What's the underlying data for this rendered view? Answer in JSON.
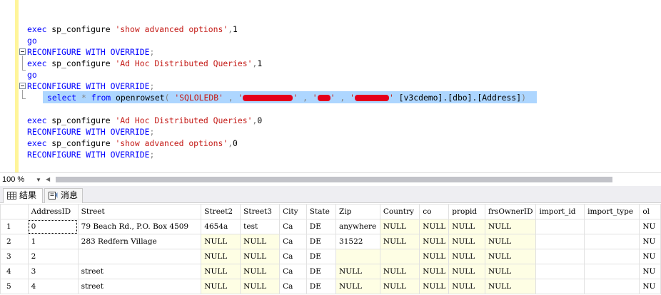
{
  "editor": {
    "lines": [
      {
        "exec": "exec",
        "proc": "sp_configure",
        "arg": "'show advanced options'",
        "sep": ",",
        "val": "1"
      },
      {
        "go": "go"
      },
      {
        "reconfig": "RECONFIGURE WITH OVERRIDE",
        "semi": ";"
      },
      {
        "exec": "exec",
        "proc": "sp_configure",
        "arg": "'Ad Hoc Distributed Queries'",
        "sep": ",",
        "val": "1"
      },
      {
        "go": "go"
      },
      {
        "reconfig": "RECONFIGURE WITH OVERRIDE",
        "semi": ";"
      },
      {
        "exec": "exec",
        "proc": "sp_configure",
        "arg": "'Ad Hoc Distributed Queries'",
        "sep": ",",
        "val": "0"
      },
      {
        "reconfig": "RECONFIGURE WITH OVERRIDE",
        "semi": ";"
      },
      {
        "exec": "exec",
        "proc": "sp_configure",
        "arg": "'show advanced options'",
        "sep": ",",
        "val": "0"
      },
      {
        "reconfig": "RECONFIGURE WITH OVERRIDE",
        "semi": ";"
      }
    ],
    "select_line": {
      "select": "select",
      "star": "*",
      "from": "from",
      "func": "openrowset",
      "open": "(",
      "provider": "'SQLOLEDB'",
      "comma1": ",",
      "q1": "'",
      "q2": "'",
      "comma2": ",",
      "q3": "'",
      "q4": "'",
      "comma3": ",",
      "q5": "'",
      "q6": "'",
      "object": "[v3cdemo].[dbo].[Address]",
      "close": ")"
    }
  },
  "zoom": {
    "value": "100 %"
  },
  "tabs": {
    "results": "结果",
    "messages": "消息"
  },
  "grid": {
    "columns": [
      "",
      "AddressID",
      "Street",
      "Street2",
      "Street3",
      "City",
      "State",
      "Zip",
      "Country",
      "co",
      "propid",
      "frsOwnerID",
      "import_id",
      "import_type",
      "ol"
    ],
    "rows": [
      [
        "1",
        "0",
        "79 Beach Rd., P.O. Box 4509",
        "4654a",
        "test",
        "Ca",
        "DE",
        "anywhere",
        "NULL",
        "NULL",
        "NULL",
        "NULL",
        "",
        "",
        "NU"
      ],
      [
        "2",
        "1",
        "283 Redfern Village",
        "NULL",
        "NULL",
        "Ca",
        "DE",
        "31522",
        "NULL",
        "NULL",
        "NULL",
        "NULL",
        "",
        "",
        "NU"
      ],
      [
        "3",
        "2",
        "",
        "NULL",
        "NULL",
        "Ca",
        "DE",
        "",
        "",
        "NULL",
        "NULL",
        "NULL",
        "",
        "",
        "NU"
      ],
      [
        "4",
        "3",
        "street",
        "NULL",
        "NULL",
        "Ca",
        "DE",
        "NULL",
        "NULL",
        "NULL",
        "NULL",
        "NULL",
        "",
        "",
        "NU"
      ],
      [
        "5",
        "4",
        "street",
        "NULL",
        "NULL",
        "Ca",
        "DE",
        "NULL",
        "NULL",
        "NULL",
        "NULL",
        "NULL",
        "",
        "",
        "NU"
      ]
    ]
  },
  "icons": {
    "results": "grid-icon",
    "messages": "message-icon"
  },
  "colors": {
    "keyword": "#0000ff",
    "string": "#c41a16",
    "selection": "#add6ff",
    "null_cell": "#fefee4",
    "change_bar": "#fff59a"
  }
}
